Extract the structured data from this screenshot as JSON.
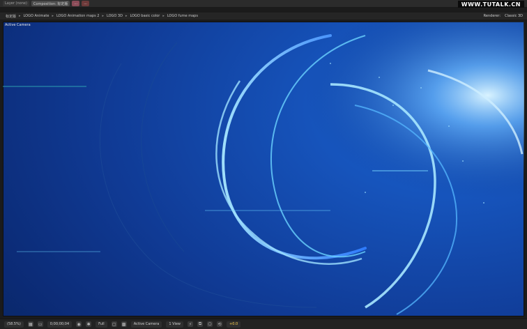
{
  "top_tabs": [
    {
      "label": "Layer (none)",
      "style": "faint"
    },
    {
      "label": "Composition: 标定版",
      "style": "active"
    },
    {
      "label": "...",
      "style": "pink"
    },
    {
      "label": "...",
      "style": "red"
    }
  ],
  "watermark": "WWW.TUTALK.CN",
  "breadcrumb": {
    "items": [
      "标定版",
      "LOGO Animate",
      "LOGO Animation maps 2",
      "LOGO 3D",
      "LOGO basic color",
      "LOGO fume maps"
    ],
    "renderer_label": "Renderer:",
    "renderer_value": "Classic 3D"
  },
  "viewer": {
    "active_camera_label": "Active Camera"
  },
  "bottom_bar": {
    "zoom": "(58.5%)",
    "timecode": "0;00;00;04",
    "resolution": "Full",
    "camera": "Active Camera",
    "views": "1 View",
    "exposure": "+0.0"
  }
}
